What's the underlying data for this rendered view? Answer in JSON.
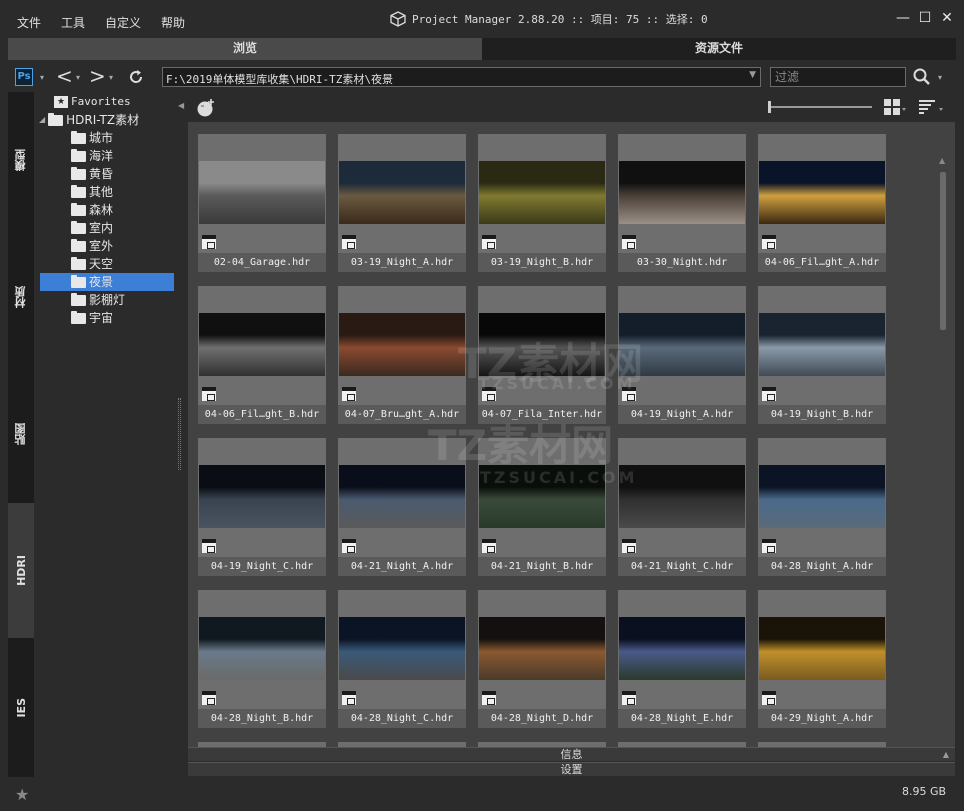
{
  "menu": {
    "file": "文件",
    "tools": "工具",
    "customize": "自定义",
    "help": "帮助"
  },
  "title": {
    "text": "Project Manager 2.88.20  :: 项目: 75  :: 选择: 0"
  },
  "window_buttons": {
    "minimize": "—",
    "maximize": "☐",
    "close": "✕"
  },
  "main_tabs": [
    {
      "label": "浏览",
      "active": true
    },
    {
      "label": "资源文件",
      "active": false
    }
  ],
  "toolbar": {
    "ps_label": "Ps",
    "path": "F:\\2019单体模型库收集\\HDRI-TZ素材\\夜景",
    "filter_placeholder": "过滤"
  },
  "side_tabs": [
    {
      "label": "模型",
      "active": false
    },
    {
      "label": "材质",
      "active": false
    },
    {
      "label": "贴图",
      "active": false
    },
    {
      "label": "HDRI",
      "active": true
    },
    {
      "label": "IES",
      "active": false
    }
  ],
  "tree": {
    "favorites": "Favorites",
    "root": "HDRI-TZ素材",
    "folders": [
      "城市",
      "海洋",
      "黄昏",
      "其他",
      "森林",
      "室内",
      "室外",
      "天空",
      "夜景",
      "影棚灯",
      "宇宙"
    ],
    "selected": "夜景"
  },
  "files": [
    "02-04_Garage.hdr",
    "03-19_Night_A.hdr",
    "03-19_Night_B.hdr",
    "03-30_Night.hdr",
    "04-06_Fil…ght_A.hdr",
    "04-06_Fil…ght_B.hdr",
    "04-07_Bru…ght_A.hdr",
    "04-07_Fila_Inter.hdr",
    "04-19_Night_A.hdr",
    "04-19_Night_B.hdr",
    "04-19_Night_C.hdr",
    "04-21_Night_A.hdr",
    "04-21_Night_B.hdr",
    "04-21_Night_C.hdr",
    "04-28_Night_A.hdr",
    "04-28_Night_B.hdr",
    "04-28_Night_C.hdr",
    "04-28_Night_D.hdr",
    "04-28_Night_E.hdr",
    "04-29_Night_A.hdr"
  ],
  "panels": {
    "info": "信息",
    "settings": "设置"
  },
  "watermark": {
    "cn": "TZ素材网",
    "en": "TZSUCAI.COM"
  },
  "status": {
    "disk": "8.95 GB"
  },
  "colors": {
    "selection": "#3d7fd6",
    "ps_blue": "#4aa3e8"
  }
}
